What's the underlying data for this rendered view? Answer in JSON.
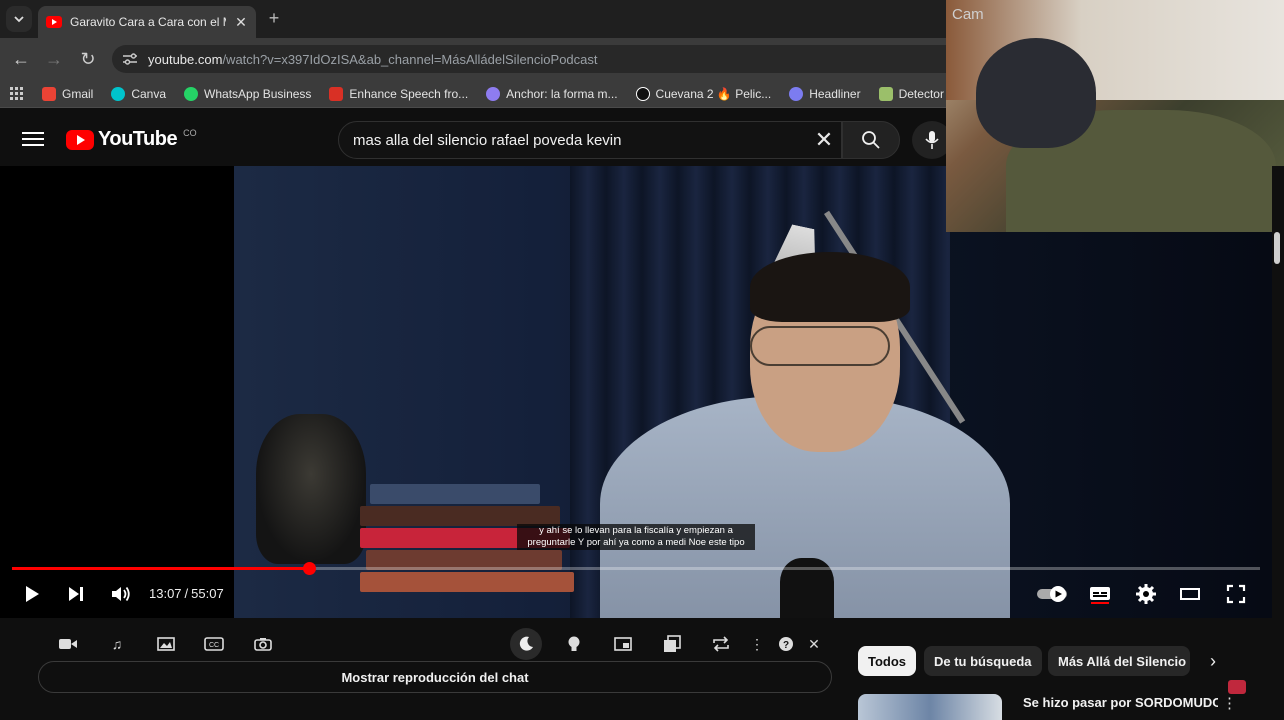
{
  "browser": {
    "tab_title": "Garavito Cara a Cara con el Mo",
    "new_tab_label": "+",
    "url_host": "youtube.com",
    "url_path": "/watch?v=x397IdOzISA&ab_channel=MásAlládelSilencioPodcast",
    "bookmarks": [
      {
        "label": "Gmail",
        "color": "#ea4335"
      },
      {
        "label": "Canva",
        "color": "#00c4cc"
      },
      {
        "label": "WhatsApp Business",
        "color": "#25d366"
      },
      {
        "label": "Enhance Speech fro...",
        "color": "#d93025"
      },
      {
        "label": "Anchor: la forma m...",
        "color": "#8e7cf0"
      },
      {
        "label": "Cuevana 2 🔥 Pelic...",
        "color": "#ffffff"
      },
      {
        "label": "Headliner",
        "color": "#7c7cf0"
      },
      {
        "label": "Detector de plagi",
        "color": "#9bbf6a"
      }
    ]
  },
  "youtube": {
    "logo_text": "YouTube",
    "logo_country": "CO",
    "search_query": "mas alla del silencio rafael poveda kevin"
  },
  "webcam": {
    "label": "Cam"
  },
  "player": {
    "subtitle_line1": "y ahí se lo llevan para la fiscalía y empiezan a",
    "subtitle_line2": "preguntarle Y por ahí ya como a medi Noe este tipo",
    "current_time": "13:07",
    "duration": "55:07",
    "progress_fraction": 0.238
  },
  "extension": {
    "chat_button_label": "Mostrar reproducción del chat"
  },
  "chips": {
    "all": "Todos",
    "search": "De tu búsqueda",
    "channel": "Más Allá del Silencio"
  },
  "related": {
    "first_title": "Se hizo pasar por SORDOMUDO"
  },
  "colors": {
    "accent": "#ff0000",
    "background": "#0f0f0f"
  }
}
